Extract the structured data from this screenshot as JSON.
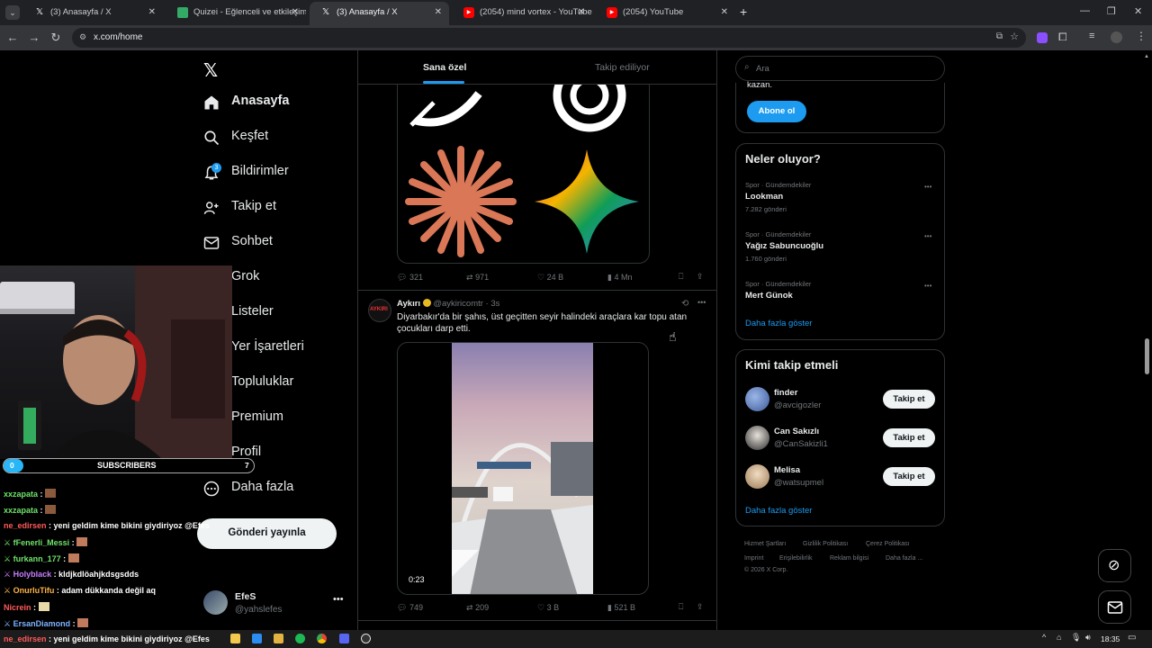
{
  "browser": {
    "tabs": [
      {
        "title": "(3) Anasayfa / X",
        "icon": "x-icon",
        "active": false
      },
      {
        "title": "Quizei - Eğlenceli ve etkileşimli",
        "icon": "quiz-icon",
        "active": false
      },
      {
        "title": "(3) Anasayfa / X",
        "icon": "x-icon",
        "active": true
      },
      {
        "title": "(2054) mind vortex - YouTube",
        "icon": "youtube-icon",
        "active": false
      },
      {
        "title": "(2054) YouTube",
        "icon": "youtube-icon",
        "active": false
      }
    ],
    "url": "x.com/home"
  },
  "sidebar": {
    "items": [
      {
        "label": "Anasayfa",
        "icon": "home-icon"
      },
      {
        "label": "Keşfet",
        "icon": "search-icon"
      },
      {
        "label": "Bildirimler",
        "icon": "bell-icon",
        "badge": "3"
      },
      {
        "label": "Takip et",
        "icon": "follow-icon"
      },
      {
        "label": "Sohbet",
        "icon": "mail-icon"
      },
      {
        "label": "Grok",
        "icon": "grok-icon"
      },
      {
        "label": "Listeler",
        "icon": "list-icon"
      },
      {
        "label": "Yer İşaretleri",
        "icon": "bookmark-icon"
      },
      {
        "label": "Topluluklar",
        "icon": "community-icon"
      },
      {
        "label": "Premium",
        "icon": "premium-icon"
      },
      {
        "label": "Profil",
        "icon": "profile-icon"
      },
      {
        "label": "Daha fazla",
        "icon": "more-icon"
      }
    ],
    "post_button": "Gönderi yayınla",
    "account": {
      "name": "EfeS",
      "handle": "@yahslefes"
    }
  },
  "feed": {
    "tabs": [
      "Sana özel",
      "Takip ediliyor"
    ],
    "post1": {
      "replies": "321",
      "reposts": "971",
      "likes": "24 B",
      "views": "4 Mn"
    },
    "post2": {
      "avatar_text": "AYKIRI",
      "name": "Aykırı",
      "handle": "@aykiricomtr",
      "time": "3s",
      "text": "Diyarbakır'da bir şahıs, üst geçitten seyir halindeki araçlara kar topu atan çocukları darp etti.",
      "video_duration": "0:23",
      "replies": "749",
      "reposts": "209",
      "likes": "3 B",
      "views": "521 B"
    }
  },
  "right": {
    "search_placeholder": "Ara",
    "premium_fragment": "kazan.",
    "subscribe_button": "Abone ol",
    "trends_title": "Neler oluyor?",
    "trends": [
      {
        "category": "Spor · Gündemdekiler",
        "name": "Lookman",
        "count": "7.282 gönderi"
      },
      {
        "category": "Spor · Gündemdekiler",
        "name": "Yağız Sabuncuoğlu",
        "count": "1.760 gönderi"
      },
      {
        "category": "Spor · Gündemdekiler",
        "name": "Mert Günok",
        "count": ""
      }
    ],
    "trends_more": "Daha fazla göster",
    "who_title": "Kimi takip etmeli",
    "who": [
      {
        "name": "finder",
        "handle": "@avcigozler",
        "button": "Takip et"
      },
      {
        "name": "Can Sakızlı",
        "handle": "@CanSakizli1",
        "button": "Takip et"
      },
      {
        "name": "Melisa",
        "handle": "@watsupmel",
        "button": "Takip et"
      }
    ],
    "who_more": "Daha fazla göster",
    "footer": [
      "Hizmet Şartları",
      "Gizlilik Politikası",
      "Çerez Politikası",
      "Imprint",
      "Erişilebilirlik",
      "Reklam bilgisi",
      "Daha fazla ...",
      "© 2026 X Corp."
    ]
  },
  "overlay": {
    "subs_left": "0",
    "subs_label": "SUBSCRIBERS",
    "subs_right": "7",
    "chat": [
      {
        "user": "xxzapata",
        "msg": "",
        "color": "#6fe36a"
      },
      {
        "user": "xxzapata",
        "msg": "",
        "color": "#6fe36a"
      },
      {
        "user": "ne_edirsen",
        "msg": "yeni geldim kime bikini giydiriyoz @Efes",
        "color": "#ff5a5a"
      },
      {
        "user": "fFenerli_Messi",
        "msg": "",
        "color": "#6fe36a"
      },
      {
        "user": "furkann_177",
        "msg": "",
        "color": "#6fe36a"
      },
      {
        "user": "Holyblack",
        "msg": "kldjkdlöahjkdsgsdds",
        "color": "#c77dff"
      },
      {
        "user": "OnurluTifu",
        "msg": "adam dükkanda değil aq",
        "color": "#ffb347"
      },
      {
        "user": "Nicrein",
        "msg": "",
        "color": "#ff5a5a"
      },
      {
        "user": "ErsanDiamond",
        "msg": "",
        "color": "#7fb2ff"
      },
      {
        "user": "ne_edirsen",
        "msg": "yeni geldim kime bikini giydiriyoz @Efes",
        "color": "#ff5a5a"
      }
    ]
  },
  "taskbar": {
    "time": "18:35"
  }
}
